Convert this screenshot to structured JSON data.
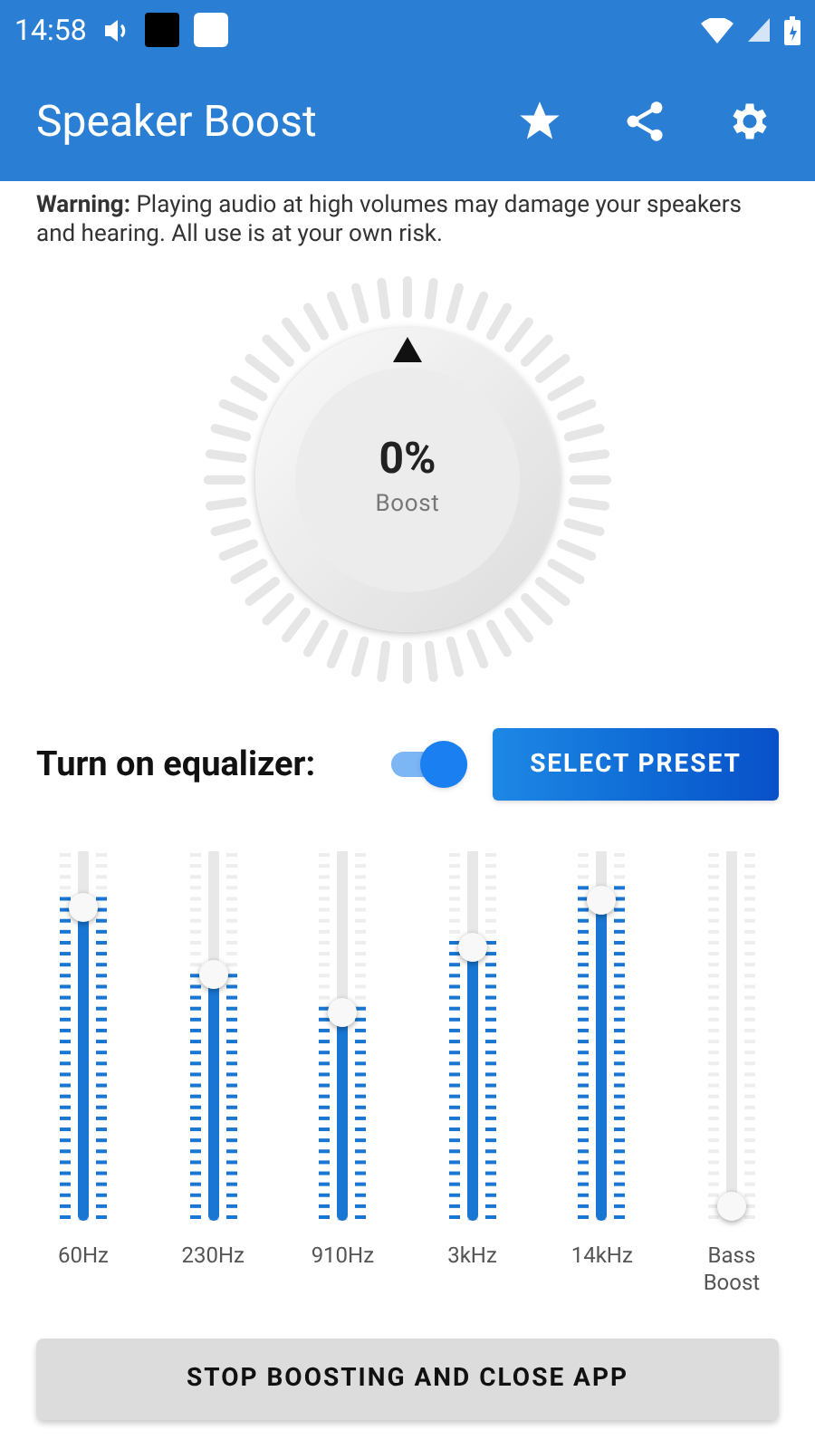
{
  "status_bar": {
    "time": "14:58"
  },
  "app_bar": {
    "title": "Speaker Boost"
  },
  "warning": "**Warning:** Playing audio at high volumes may damage your speakers and hearing. All use is at your own risk.",
  "boost": {
    "value": "0%",
    "label": "Boost"
  },
  "equalizer": {
    "label": "Turn on equalizer:",
    "on": true,
    "preset_button": "SELECT PRESET"
  },
  "bands": [
    {
      "label": "60Hz",
      "level": 0.88
    },
    {
      "label": "230Hz",
      "level": 0.68
    },
    {
      "label": "910Hz",
      "level": 0.57
    },
    {
      "label": "3kHz",
      "level": 0.76
    },
    {
      "label": "14kHz",
      "level": 0.9
    },
    {
      "label": "Bass Boost",
      "level": 0
    }
  ],
  "stop_button": "STOP BOOSTING AND CLOSE APP"
}
